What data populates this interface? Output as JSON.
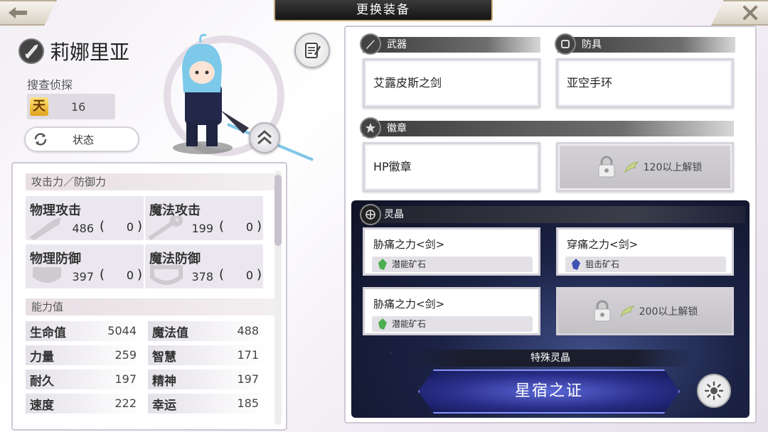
{
  "header": {
    "title": "更换装备"
  },
  "character": {
    "name": "莉娜里亚",
    "title": "搜查侦探",
    "rank_badge": "天",
    "rank_value": "16",
    "status_label": "状态"
  },
  "stats": {
    "section1_label": "攻击力／防御力",
    "combat": [
      {
        "name": "物理攻击",
        "value": "486",
        "bonus": "0"
      },
      {
        "name": "魔法攻击",
        "value": "199",
        "bonus": "0"
      },
      {
        "name": "物理防御",
        "value": "397",
        "bonus": "0"
      },
      {
        "name": "魔法防御",
        "value": "378",
        "bonus": "0"
      }
    ],
    "section2_label": "能力值",
    "abilities": [
      {
        "name": "生命值",
        "value": "5044"
      },
      {
        "name": "魔法值",
        "value": "488"
      },
      {
        "name": "力量",
        "value": "259"
      },
      {
        "name": "智慧",
        "value": "171"
      },
      {
        "name": "耐久",
        "value": "197"
      },
      {
        "name": "精神",
        "value": "197"
      },
      {
        "name": "速度",
        "value": "222"
      },
      {
        "name": "幸运",
        "value": "185"
      }
    ]
  },
  "equipment": {
    "weapon_label": "武器",
    "weapon_item": "艾露皮斯之剑",
    "armor_label": "防具",
    "armor_item": "亚空手环",
    "badge_label": "徽章",
    "badge_item": "HP徽章",
    "badge_locked_text": "120以上解锁"
  },
  "crystals": {
    "label": "灵晶",
    "slots": [
      {
        "name": "胁痛之力<剑>",
        "type": "潜能矿石",
        "gem_color": "#4caf50"
      },
      {
        "name": "穿痛之力<剑>",
        "type": "狙击矿石",
        "gem_color": "#3f51b5"
      },
      {
        "name": "胁痛之力<剑>",
        "type": "潜能矿石",
        "gem_color": "#4caf50"
      }
    ],
    "locked_text": "200以上解锁",
    "special_label": "特殊灵晶",
    "special_button": "星宿之证"
  }
}
